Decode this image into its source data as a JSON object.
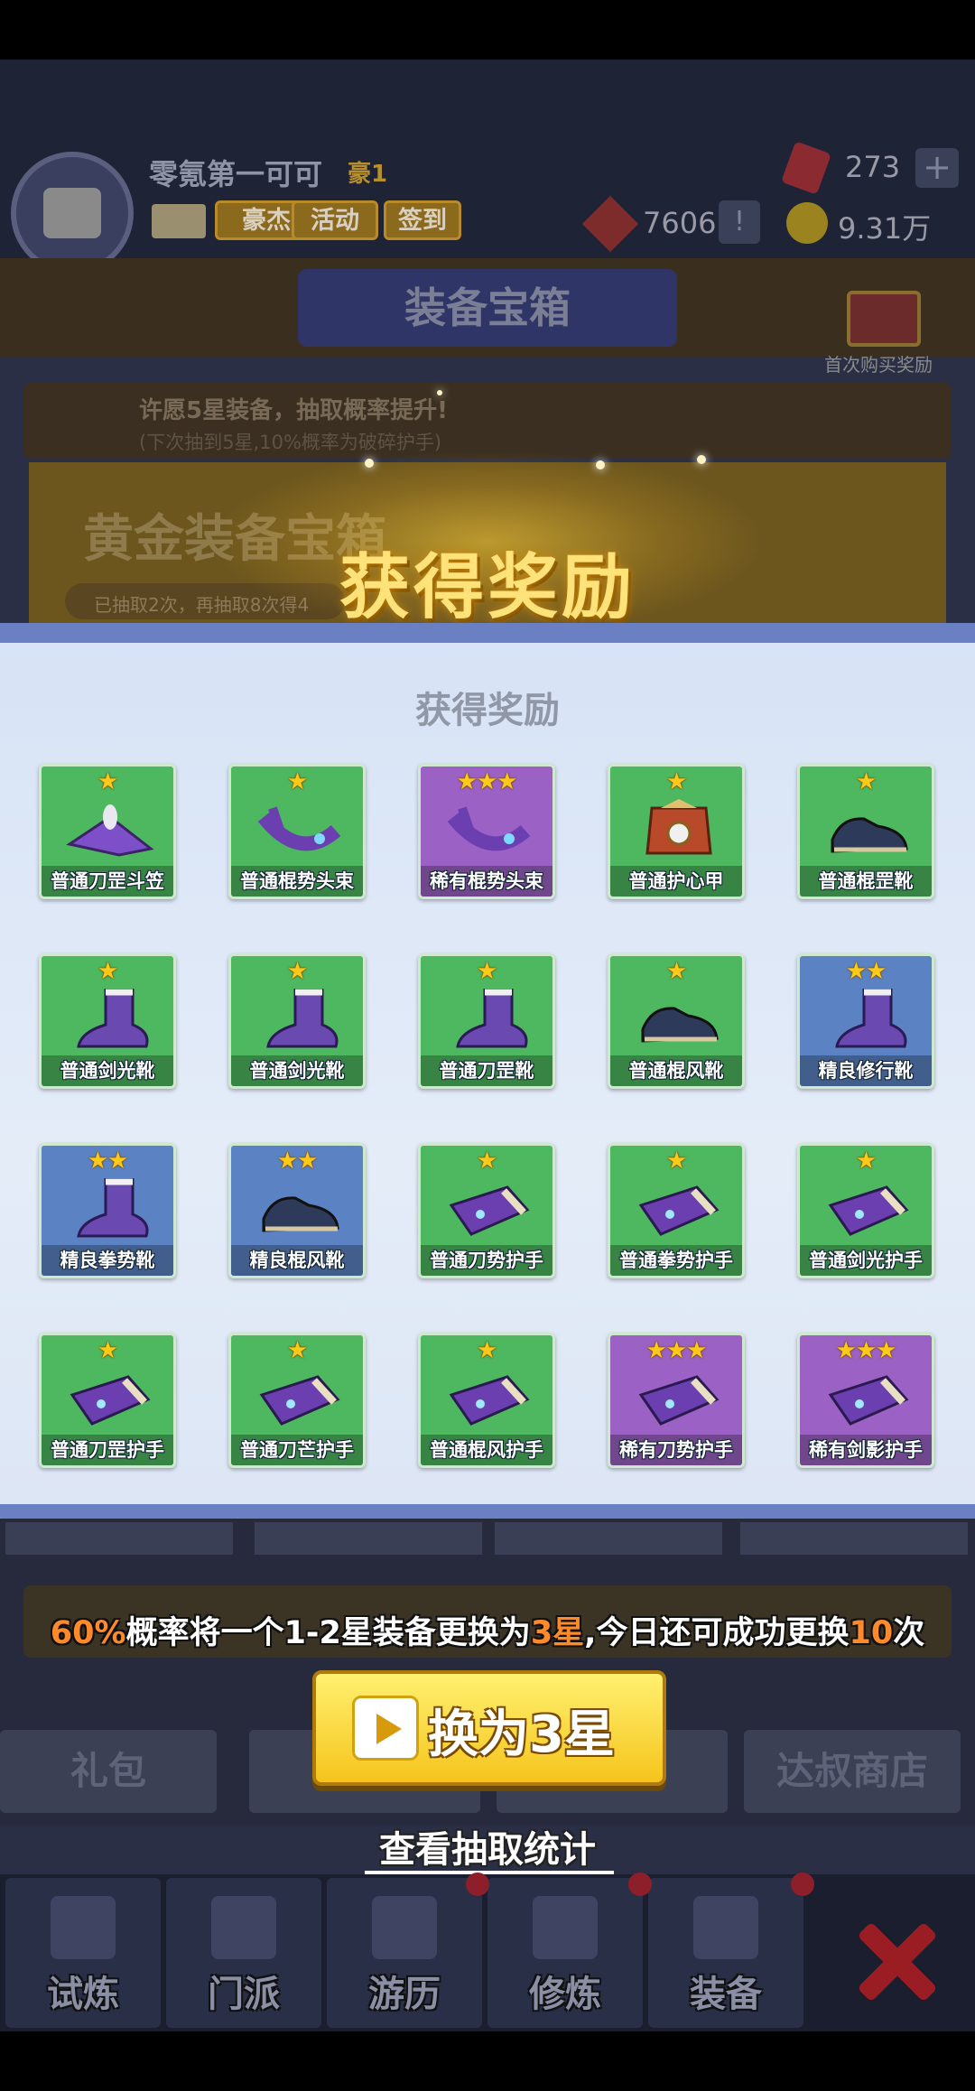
{
  "player": {
    "name": "零氪第一可可",
    "vip": "豪1"
  },
  "top_buttons": {
    "hero": "豪杰",
    "event": "活动",
    "checkin": "签到"
  },
  "currency": {
    "gems": "273",
    "plus": "+",
    "tokens": "7606",
    "token_info": "!",
    "coins": "9.31万"
  },
  "shop": {
    "title": "装备宝箱",
    "first_purchase_reward": "首次购买奖励",
    "wish_text": "许愿5星装备，抽取概率提升!",
    "wish_sub": "(下次抽到5星,10%概率为破碎护手)",
    "chest_name": "黄金装备宝箱",
    "chest_note": "已抽取2次，再抽取8次得4"
  },
  "reward_header": "获得奖励",
  "panel_title": "获得奖励",
  "star_glyph": "★",
  "rewards": [
    {
      "name": "普通刀罡斗笠",
      "rarity": "common",
      "stars": 1,
      "icon": "hat-icon"
    },
    {
      "name": "普通棍势头束",
      "rarity": "common",
      "stars": 1,
      "icon": "headband-icon"
    },
    {
      "name": "稀有棍势头束",
      "rarity": "rare",
      "stars": 3,
      "icon": "headband-icon"
    },
    {
      "name": "普通护心甲",
      "rarity": "common",
      "stars": 1,
      "icon": "armor-icon"
    },
    {
      "name": "普通棍罡靴",
      "rarity": "common",
      "stars": 1,
      "icon": "shoe-icon"
    },
    {
      "name": "普通剑光靴",
      "rarity": "common",
      "stars": 1,
      "icon": "boot-icon"
    },
    {
      "name": "普通剑光靴",
      "rarity": "common",
      "stars": 1,
      "icon": "boot-icon"
    },
    {
      "name": "普通刀罡靴",
      "rarity": "common",
      "stars": 1,
      "icon": "boot-icon"
    },
    {
      "name": "普通棍风靴",
      "rarity": "common",
      "stars": 1,
      "icon": "shoe-icon"
    },
    {
      "name": "精良修行靴",
      "rarity": "fine",
      "stars": 2,
      "icon": "boot-icon"
    },
    {
      "name": "精良拳势靴",
      "rarity": "fine",
      "stars": 2,
      "icon": "boot-icon"
    },
    {
      "name": "精良棍风靴",
      "rarity": "fine",
      "stars": 2,
      "icon": "shoe-icon"
    },
    {
      "name": "普通刀势护手",
      "rarity": "common",
      "stars": 1,
      "icon": "bracer-icon"
    },
    {
      "name": "普通拳势护手",
      "rarity": "common",
      "stars": 1,
      "icon": "bracer-icon"
    },
    {
      "name": "普通剑光护手",
      "rarity": "common",
      "stars": 1,
      "icon": "bracer-icon"
    },
    {
      "name": "普通刀罡护手",
      "rarity": "common",
      "stars": 1,
      "icon": "bracer-icon"
    },
    {
      "name": "普通刀芒护手",
      "rarity": "common",
      "stars": 1,
      "icon": "bracer-icon"
    },
    {
      "name": "普通棍风护手",
      "rarity": "common",
      "stars": 1,
      "icon": "bracer-icon"
    },
    {
      "name": "稀有刀势护手",
      "rarity": "rare",
      "stars": 3,
      "icon": "bracer-icon"
    },
    {
      "name": "稀有剑影护手",
      "rarity": "rare",
      "stars": 3,
      "icon": "bracer-icon"
    }
  ],
  "upgrade_notice": {
    "percent": "60%",
    "text1": "概率将一个1-2星装备更换为",
    "stars": "3星",
    "text2": ",今日还可成功更换",
    "count": "10",
    "text3": "次"
  },
  "upgrade_button": "换为3星",
  "stats_link": "查看抽取统计",
  "background_tabs": {
    "gift": "礼包",
    "uncle_shop": "达叔商店"
  },
  "nav": [
    "试炼",
    "门派",
    "游历",
    "修炼",
    "装备"
  ],
  "colors": {
    "common": "#4db860",
    "fine": "#5b83c4",
    "rare": "#9b61c4",
    "highlight": "#ff8a2a",
    "star": "#ffc917",
    "button_yellow": "#f5c41c",
    "panel_border": "#6a80c2"
  }
}
